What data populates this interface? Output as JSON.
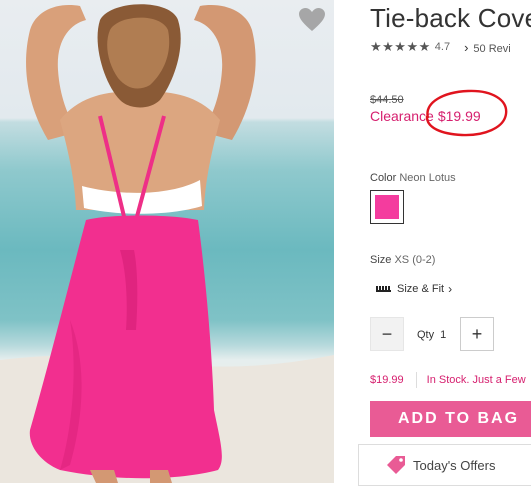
{
  "product": {
    "title": "Tie-back Cove",
    "rating": {
      "stars": "★★★★★",
      "value": "4.7",
      "reviews_label": "50 Revi"
    },
    "price": {
      "original": "$44.50",
      "clearance_label": "Clearance",
      "clearance_price": "$19.99"
    },
    "color": {
      "label": "Color",
      "selected": "Neon Lotus",
      "swatch_hex": "#f43c9e"
    },
    "size": {
      "label": "Size",
      "selected": "XS (0-2)",
      "size_fit_label": "Size & Fit"
    },
    "quantity": {
      "label": "Qty",
      "value": "1",
      "minus": "−",
      "plus": "+"
    },
    "stock": {
      "price": "$19.99",
      "status": "In Stock. Just a Few"
    },
    "add_to_bag_label": "ADD TO BAG",
    "offers_label": "Today's Offers"
  },
  "icons": {
    "wishlist": "heart-icon",
    "reviews_chevron": "chevron-right-icon",
    "size_fit": "ruler-icon",
    "offers": "tag-icon"
  },
  "colors": {
    "accent_pink": "#e95b95",
    "price_pink": "#d6206f",
    "annotation_red": "#e0141e"
  }
}
